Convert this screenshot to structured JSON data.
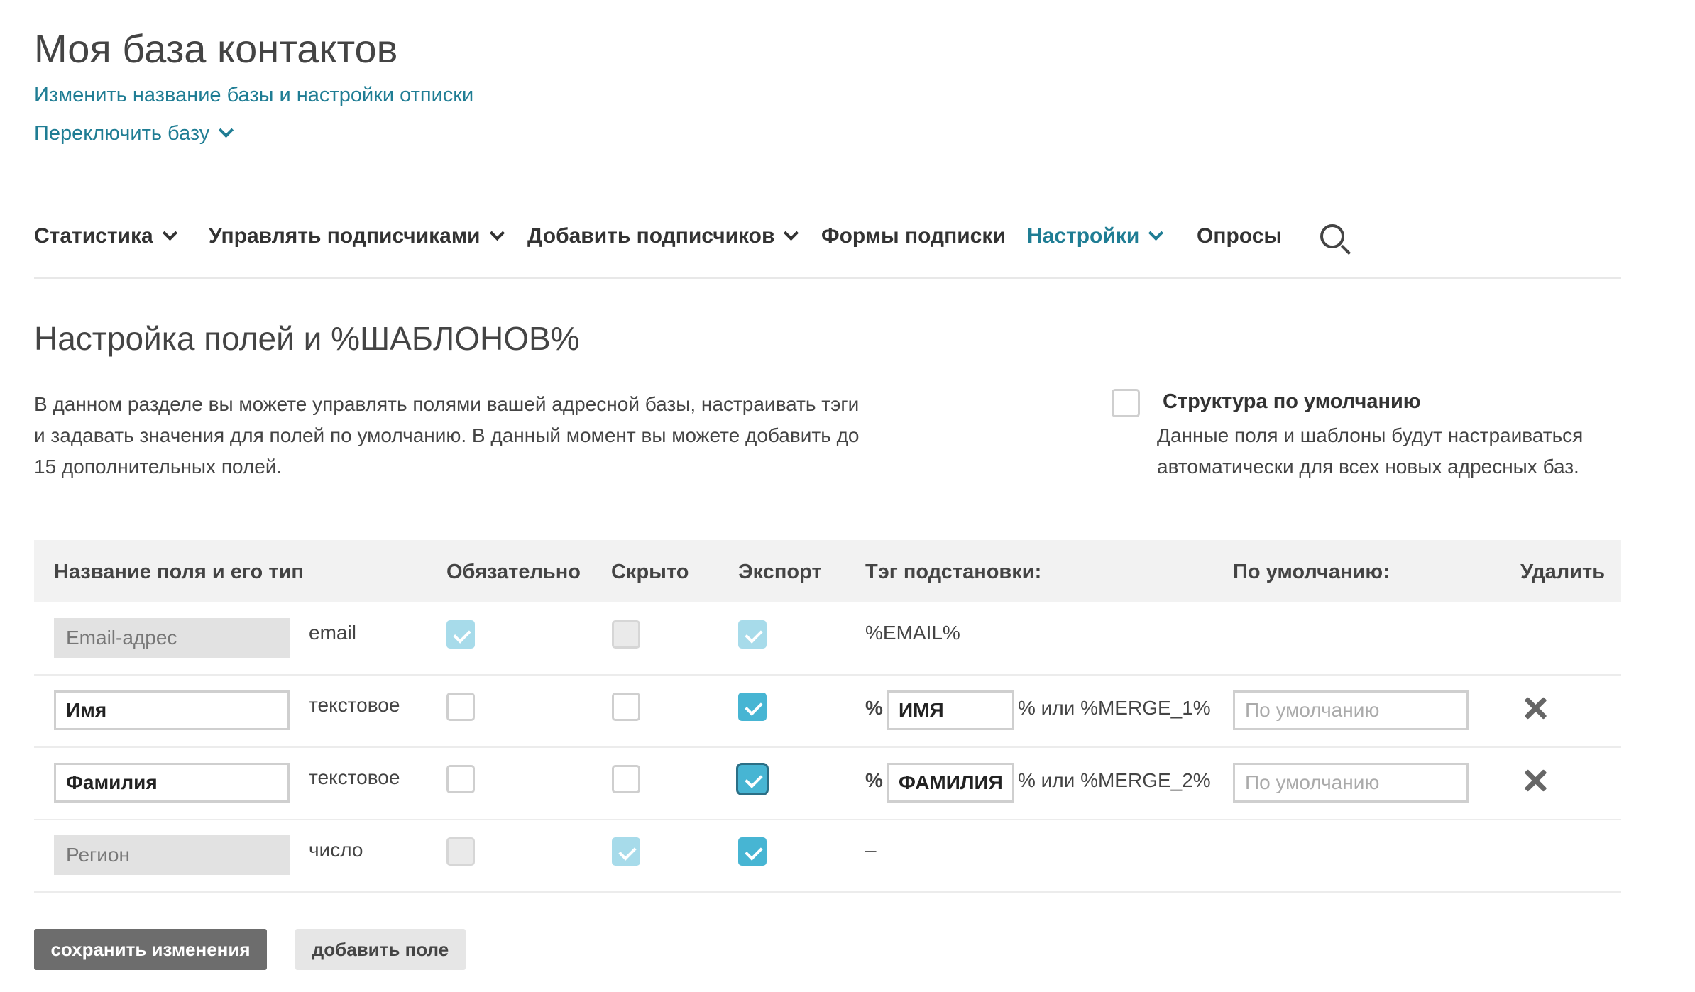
{
  "header": {
    "title": "Моя база контактов",
    "rename_link": "Изменить название базы и настройки отписки",
    "switch_link": "Переключить базу"
  },
  "nav": {
    "items": [
      {
        "label": "Статистика",
        "dropdown": true
      },
      {
        "label": "Управлять подписчиками",
        "dropdown": true
      },
      {
        "label": "Добавить подписчиков",
        "dropdown": true
      },
      {
        "label": "Формы подписки",
        "dropdown": false
      },
      {
        "label": "Настройки",
        "dropdown": true,
        "active": true
      },
      {
        "label": "Опросы",
        "dropdown": false
      }
    ],
    "search_icon": "search-icon"
  },
  "section": {
    "title": "Настройка полей и %ШАБЛОНОВ%",
    "description": "В данном разделе вы можете управлять полями вашей адресной базы, настраивать тэги и задавать значения для полей по умолчанию. В данный момент вы можете добавить до 15 дополнительных полей."
  },
  "default_structure": {
    "label": "Структура по умолчанию",
    "description": "Данные поля и шаблоны будут настраиваться автоматически для всех новых адресных баз.",
    "checked": false
  },
  "table": {
    "headers": [
      "Название поля и его тип",
      "Обязательно",
      "Скрыто",
      "Экспорт",
      "Тэг подстановки:",
      "По умолчанию:",
      "Удалить"
    ],
    "rows": [
      {
        "name": "Email-адрес",
        "type": "email",
        "required": true,
        "hidden": false,
        "export": true,
        "tag_static": "%EMAIL%"
      },
      {
        "name": "Имя",
        "type": "текстовое",
        "required": false,
        "hidden": false,
        "export": true,
        "tag_prefix": "%",
        "tag_value": "ИМЯ",
        "tag_suffix": "% или %MERGE_1%",
        "default_placeholder": "По умолчанию"
      },
      {
        "name": "Фамилия",
        "type": "текстовое",
        "required": false,
        "hidden": false,
        "export": true,
        "tag_prefix": "%",
        "tag_value": "ФАМИЛИЯ",
        "tag_suffix": "% или %MERGE_2%",
        "default_placeholder": "По умолчанию"
      },
      {
        "name": "Регион",
        "type": "число",
        "required": false,
        "hidden": true,
        "export": true,
        "tag_static": "–"
      }
    ]
  },
  "buttons": {
    "save": "сохранить изменения",
    "add": "добавить поле"
  },
  "colors": {
    "accent": "#1f7d94",
    "checkbox": "#47b5d3"
  }
}
